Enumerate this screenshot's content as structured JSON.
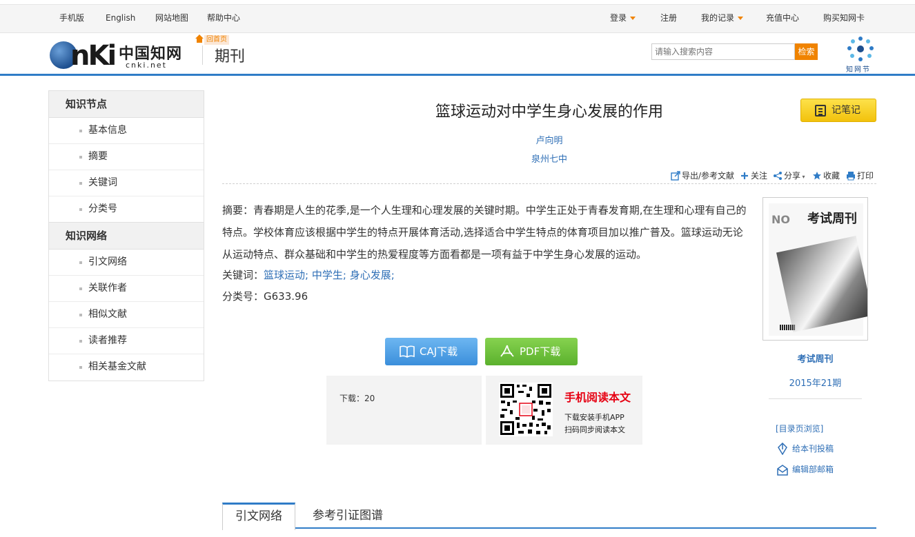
{
  "topbar": {
    "left_links": [
      "手机版",
      "English",
      "网站地图",
      "帮助中心"
    ],
    "right_links": [
      {
        "label": "登录",
        "has_caret": true
      },
      {
        "label": "注册",
        "has_caret": false
      },
      {
        "label": "我的记录",
        "has_caret": true
      },
      {
        "label": "充值中心",
        "has_caret": false
      },
      {
        "label": "购买知网卡",
        "has_caret": false
      }
    ]
  },
  "header": {
    "logo_text": "CNKI",
    "logo_cn": "中国知网",
    "logo_url": "cnki.net",
    "home_tag": "回首页",
    "section_title": "期刊",
    "search_placeholder": "请输入搜索内容",
    "search_button": "检索",
    "zwj_label": "知网节"
  },
  "sidebar": {
    "groups": [
      {
        "title": "知识节点",
        "items": [
          "基本信息",
          "摘要",
          "关键词",
          "分类号"
        ]
      },
      {
        "title": "知识网络",
        "items": [
          "引文网络",
          "关联作者",
          "相似文献",
          "读者推荐",
          "相关基金文献"
        ]
      }
    ]
  },
  "article": {
    "title": "篮球运动对中学生身心发展的作用",
    "note_button": "记笔记",
    "author": "卢向明",
    "organization": "泉州七中",
    "tools": [
      "导出/参考文献",
      "关注",
      "分享",
      "收藏",
      "打印"
    ],
    "abstract_label": "摘要：",
    "abstract": "青春期是人生的花季,是一个人生理和心理发展的关键时期。中学生正处于青春发育期,在生理和心理有自己的特点。学校体育应该根据中学生的特点开展体育活动,选择适合中学生特点的体育项目加以推广普及。篮球运动无论从运动特点、群众基础和中学生的热爱程度等方面看都是一项有益于中学生身心发展的运动。",
    "keywords_label": "关键词：",
    "keywords": [
      "篮球运动;",
      "中学生;",
      "身心发展;"
    ],
    "class_label": "分类号：",
    "class_no": "G633.96",
    "caj_button": "CAJ下载",
    "pdf_button": "PDF下载",
    "downloads_label": "下载：",
    "downloads": "20",
    "mobile_title": "手机阅读本文",
    "mobile_line1": "下载安装手机APP",
    "mobile_line2": "扫码同步阅读本文"
  },
  "journal": {
    "cover_no": "NO",
    "cover_brand": "考试周刊",
    "name": "考试周刊",
    "issue": "2015年21期",
    "toc_link": "[目录页浏览]",
    "submit_link": "给本刊投稿",
    "email_link": "编辑部邮箱"
  },
  "tabs": [
    "引文网络",
    "参考引证图谱"
  ],
  "colors": {
    "accent_blue": "#2f7cc7",
    "link_blue": "#2f6fb6",
    "orange": "#f08300",
    "note_yellow": "#f5c60f",
    "caj_blue": "#4a9de3",
    "pdf_green": "#6cc23a",
    "red": "#e60012"
  }
}
